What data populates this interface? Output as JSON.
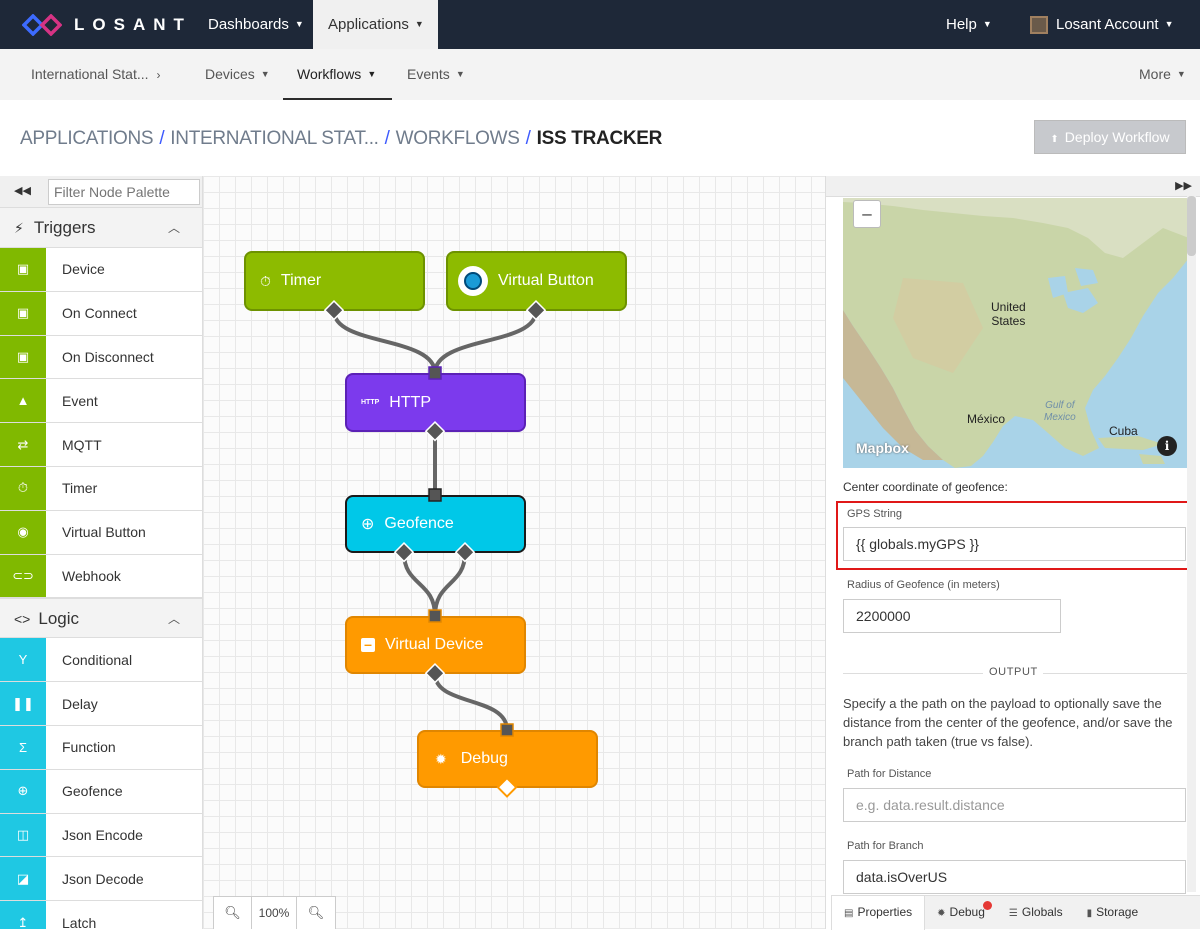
{
  "topnav": {
    "brand": "LOSANT",
    "items": [
      {
        "label": "Dashboards"
      },
      {
        "label": "Applications"
      }
    ],
    "help": "Help",
    "account": "Losant Account"
  },
  "subnav": {
    "app": "International Stat...",
    "devices": "Devices",
    "workflows": "Workflows",
    "events": "Events",
    "more": "More"
  },
  "breadcrumb": {
    "c1": "APPLICATIONS",
    "c2": "INTERNATIONAL STAT...",
    "c3": "WORKFLOWS",
    "c4": "ISS TRACKER",
    "sep": "/"
  },
  "deploy_label": "Deploy Workflow",
  "palette": {
    "filter_placeholder": "Filter Node Palette",
    "triggers_title": "Triggers",
    "triggers": [
      {
        "label": "Device",
        "icon": "chip-icon"
      },
      {
        "label": "On Connect",
        "icon": "chip-icon"
      },
      {
        "label": "On Disconnect",
        "icon": "chip-icon"
      },
      {
        "label": "Event",
        "icon": "warning-icon"
      },
      {
        "label": "MQTT",
        "icon": "swap-icon"
      },
      {
        "label": "Timer",
        "icon": "stopwatch-icon"
      },
      {
        "label": "Virtual Button",
        "icon": "radio-icon"
      },
      {
        "label": "Webhook",
        "icon": "link-icon"
      }
    ],
    "logic_title": "Logic",
    "logic": [
      {
        "label": "Conditional",
        "icon": "branch-icon"
      },
      {
        "label": "Delay",
        "icon": "pause-icon"
      },
      {
        "label": "Function",
        "icon": "sigma-icon"
      },
      {
        "label": "Geofence",
        "icon": "crosshair-icon"
      },
      {
        "label": "Json Encode",
        "icon": "encode-icon"
      },
      {
        "label": "Json Decode",
        "icon": "decode-icon"
      },
      {
        "label": "Latch",
        "icon": "latch-icon"
      }
    ]
  },
  "workflow": {
    "nodes": {
      "timer": "Timer",
      "vbutton": "Virtual Button",
      "http": "HTTP",
      "http_tag": "HTTP",
      "geofence": "Geofence",
      "vdevice": "Virtual Device",
      "debug": "Debug"
    },
    "colors": {
      "trigger": "#8dbb00",
      "http": "#7c3aed",
      "geofence": "#00c8e8",
      "output": "#ff9a00"
    },
    "zoom": "100%"
  },
  "properties": {
    "map": {
      "attribution": "Mapbox",
      "labels": {
        "us": "United\nStates",
        "mexico": "México",
        "gulf": "Gulf of\nMexico",
        "cuba": "Cuba"
      }
    },
    "center_label": "Center coordinate of geofence:",
    "gps_label": "GPS String",
    "gps_value": "{{ globals.myGPS }}",
    "radius_label": "Radius of Geofence (in meters)",
    "radius_value": "2200000",
    "output_title": "OUTPUT",
    "output_desc": "Specify a the path on the payload to optionally save the distance from the center of the geofence, and/or save the branch path taken (true vs false).",
    "distance_label": "Path for Distance",
    "distance_placeholder": "e.g. data.result.distance",
    "branch_label": "Path for Branch",
    "branch_value": "data.isOverUS"
  },
  "bottom_tabs": [
    "Properties",
    "Debug",
    "Globals",
    "Storage"
  ]
}
